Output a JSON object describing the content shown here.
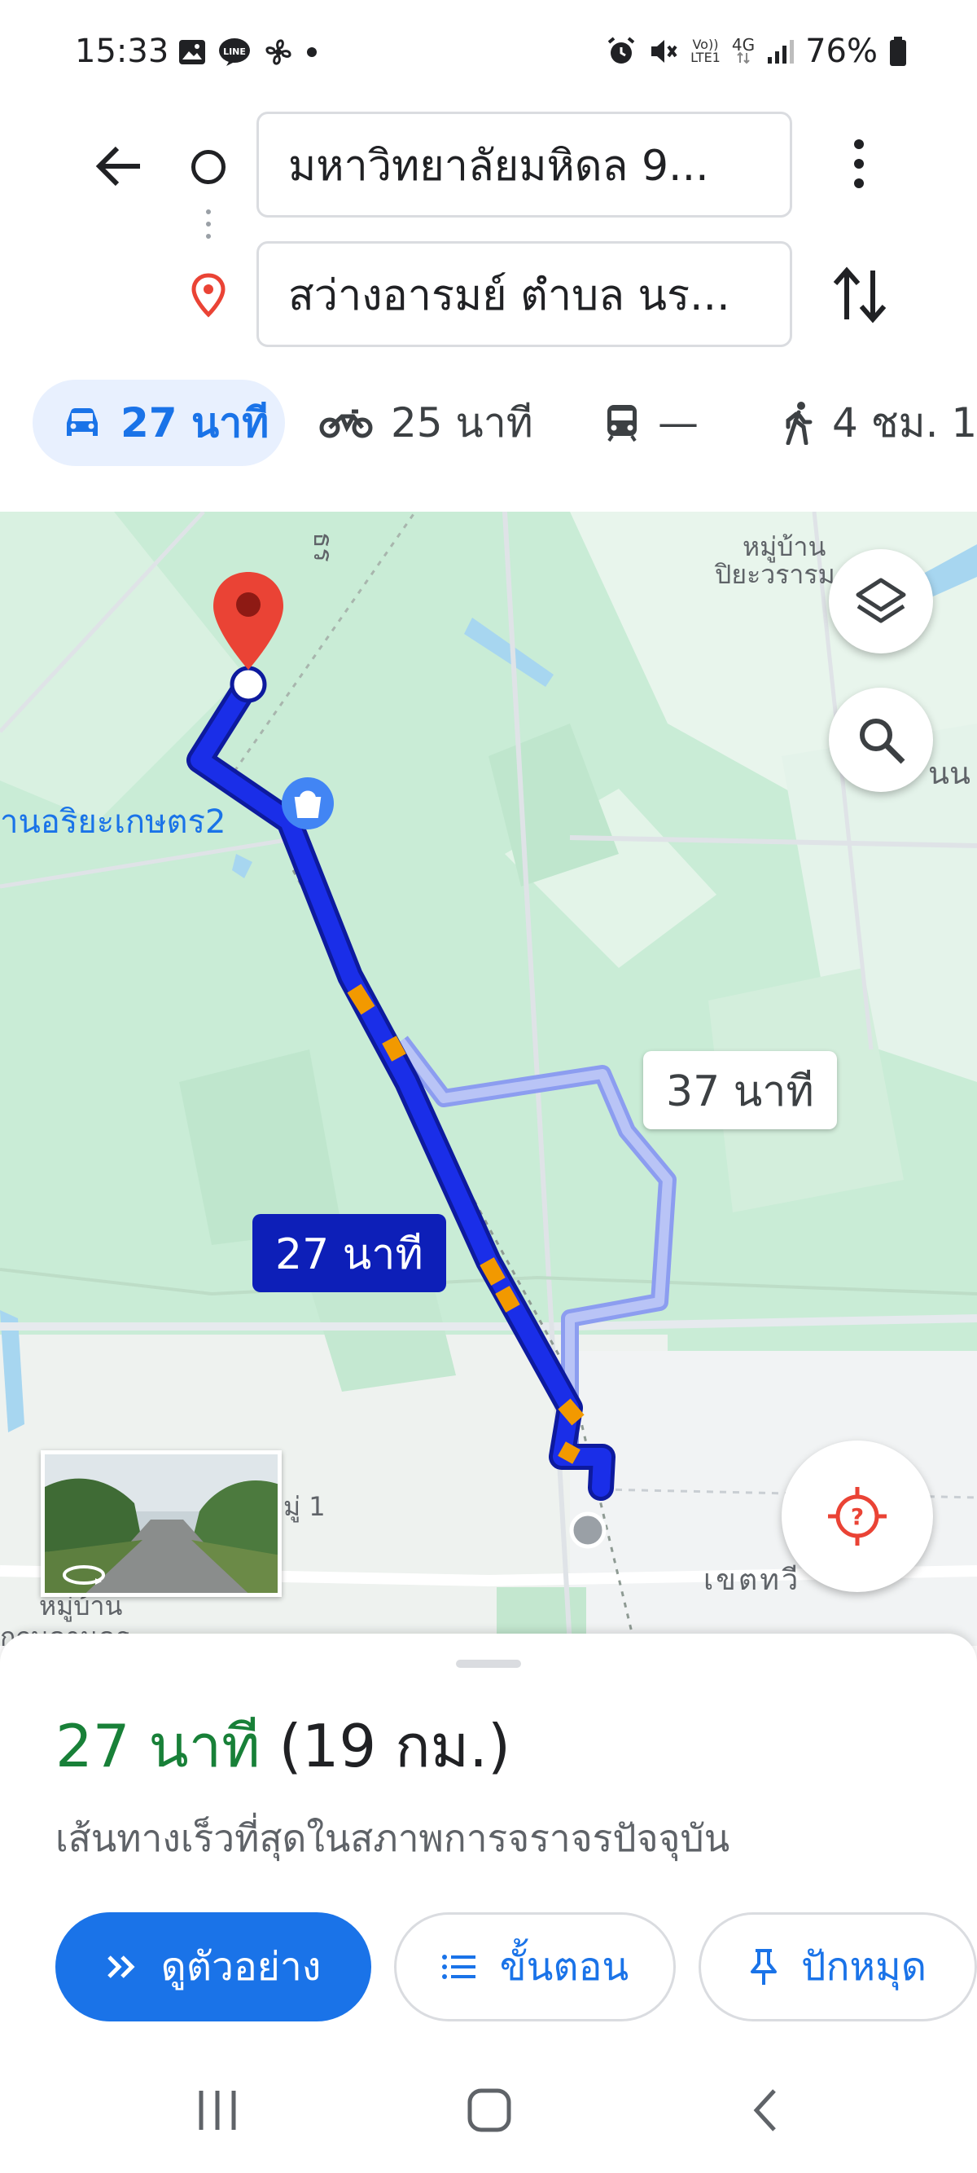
{
  "status_bar": {
    "time": "15:33",
    "left_icons": [
      "gallery-icon",
      "line-chat-icon",
      "fan-icon",
      "dot-icon"
    ],
    "network_top": "Vo))",
    "network_bottom": "LTE1",
    "network_type": "4G",
    "battery": "76%"
  },
  "directions": {
    "origin": "มหาวิทยาลัยมหิดล 9...",
    "destination": "สว่างอารมย์ ตำบล นร..."
  },
  "travel_modes": [
    {
      "icon": "car-icon",
      "label": "27 นาที",
      "active": true
    },
    {
      "icon": "motorcycle-icon",
      "label": "25 นาที",
      "active": false
    },
    {
      "icon": "transit-icon",
      "label": "—",
      "active": false
    },
    {
      "icon": "walk-icon",
      "label": "4 ชม. 1",
      "active": false
    }
  ],
  "map": {
    "labels": {
      "village_top_1": "หมู่บ้าน",
      "village_top_2": "ปิยะวรารม",
      "road_top": "ธร",
      "shop": "านอริยะเกษตร2",
      "right_edge": "นน",
      "moo_1": "มู่ 1",
      "district": "เขตทวี",
      "village_bottom_1": "หมู่บ้าน",
      "village_bottom_2": "กฤษดานคร"
    },
    "route_primary_label": "27 นาที",
    "route_alt_label": "37 นาที",
    "colors": {
      "route_primary": "#1a2ee8",
      "route_alt": "#a6b4f2",
      "traffic": "#f29900",
      "pin": "#ea4335"
    }
  },
  "summary": {
    "duration": "27 นาที",
    "distance": "(19 กม.)",
    "subtitle": "เส้นทางเร็วที่สุดในสภาพการจราจรปัจจุบัน"
  },
  "actions": {
    "preview": "ดูตัวอย่าง",
    "steps": "ขั้นตอน",
    "pin": "ปักหมุด"
  }
}
